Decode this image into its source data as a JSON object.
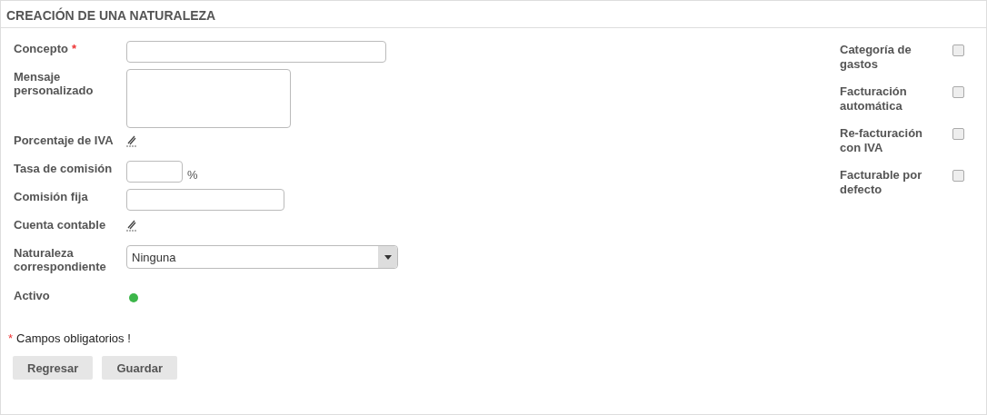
{
  "title": "CREACIÓN DE UNA NATURALEZA",
  "fields": [
    {
      "kind": "wide-input",
      "label": "Concepto",
      "required_mark": "*"
    },
    {
      "kind": "textarea",
      "label": "Mensaje personalizado"
    },
    {
      "kind": "edit",
      "label": "Porcentaje de IVA"
    },
    {
      "kind": "percent",
      "label": "Tasa de comisión",
      "unit": "%"
    },
    {
      "kind": "medium-input",
      "label": "Comisión fija"
    },
    {
      "kind": "edit",
      "label": "Cuenta contable"
    },
    {
      "kind": "select",
      "label": "Naturaleza correspondiente",
      "value": "Ninguna"
    },
    {
      "kind": "status",
      "label": "Activo",
      "active": true
    }
  ],
  "options": [
    {
      "label": "Categoría de gastos",
      "checked": false
    },
    {
      "label": "Facturación automática",
      "checked": false
    },
    {
      "label": "Re-facturación con IVA",
      "checked": false
    },
    {
      "label": "Facturable por defecto",
      "checked": false
    }
  ],
  "note": {
    "mark": "*",
    "text": "Campos obligatorios !"
  },
  "buttons": [
    "Regresar",
    "Guardar"
  ]
}
